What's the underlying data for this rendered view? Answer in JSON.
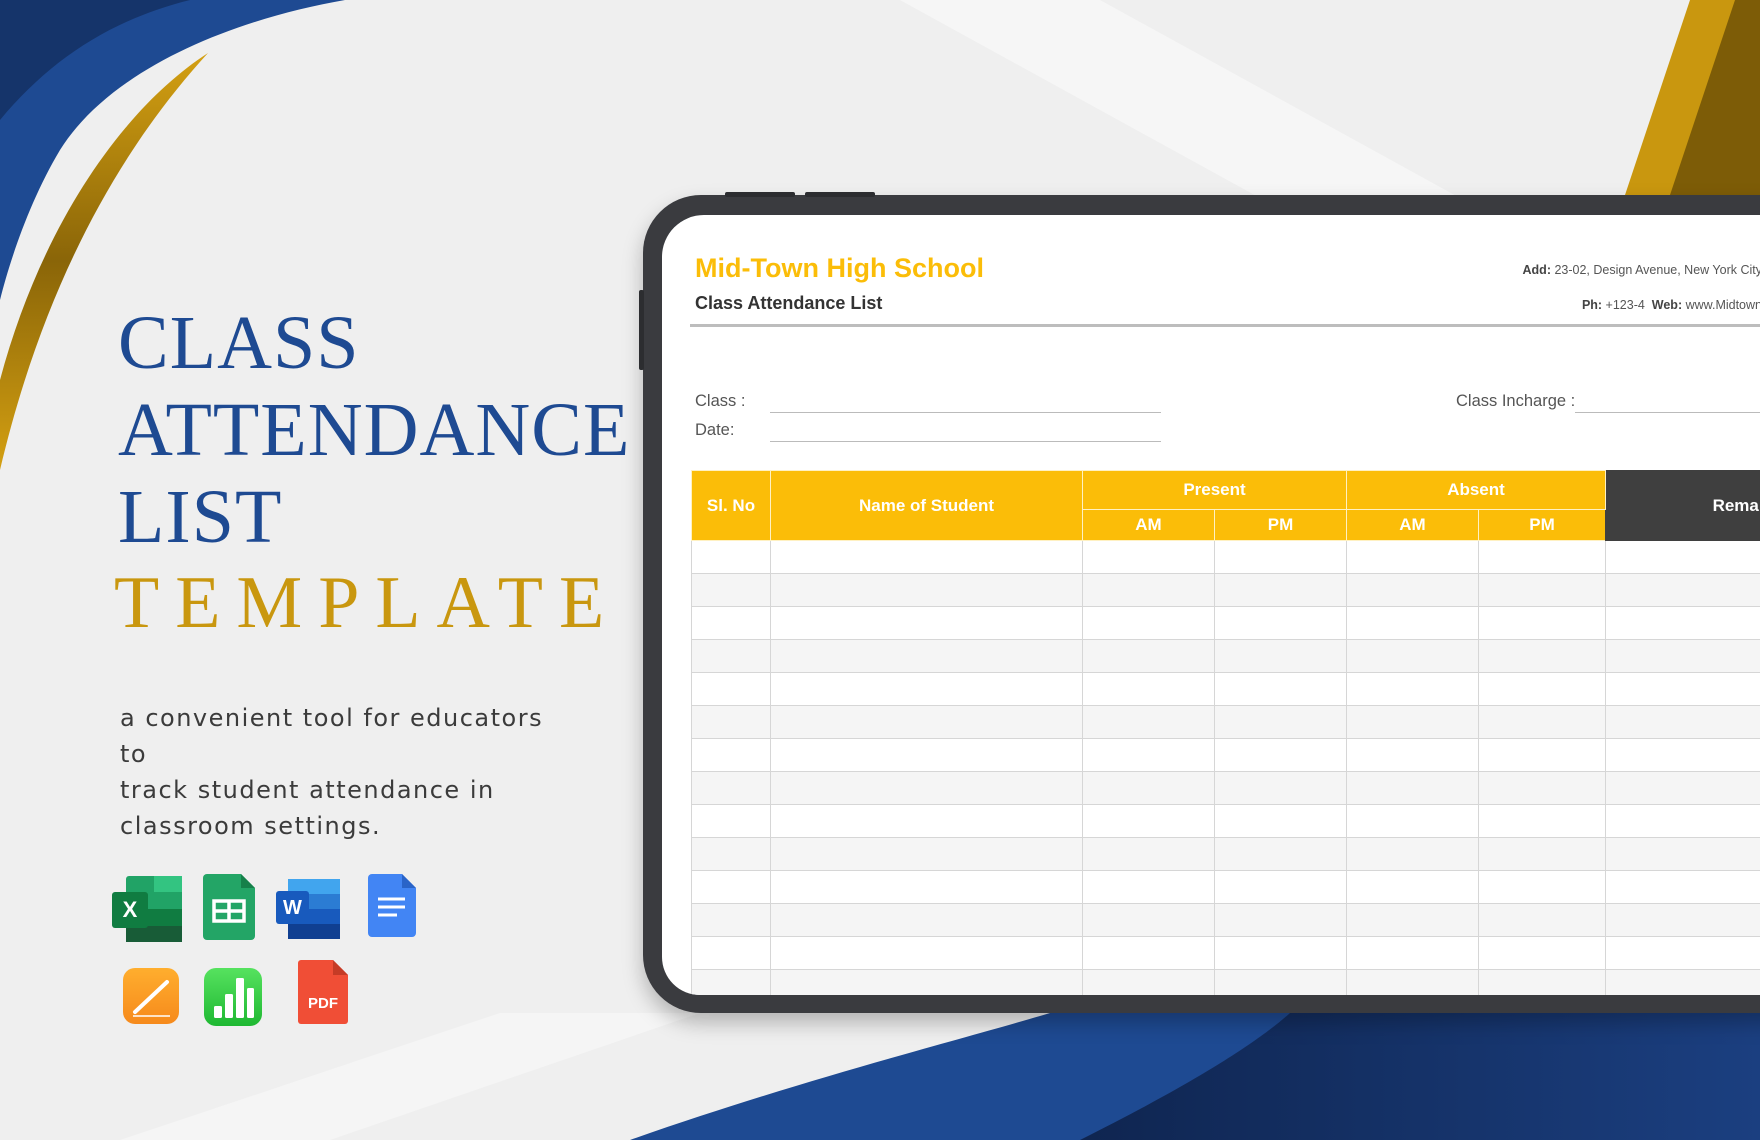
{
  "hero": {
    "title_lines": [
      "CLASS",
      "ATTENDANCE",
      "LIST"
    ],
    "subtitle": "TEMPLATE",
    "description_lines": [
      "a convenient tool for educators to",
      "track student attendance in",
      "classroom settings."
    ]
  },
  "formats": [
    {
      "name": "Microsoft Excel",
      "icon": "excel-icon",
      "letter": "X"
    },
    {
      "name": "Google Sheets",
      "icon": "google-sheets-icon"
    },
    {
      "name": "Microsoft Word",
      "icon": "word-icon",
      "letter": "W"
    },
    {
      "name": "Google Docs",
      "icon": "google-docs-icon"
    },
    {
      "name": "Apple Pages",
      "icon": "pages-icon"
    },
    {
      "name": "Apple Numbers",
      "icon": "numbers-icon"
    },
    {
      "name": "PDF",
      "icon": "pdf-icon",
      "label": "PDF"
    }
  ],
  "document": {
    "school_name": "Mid-Town High School",
    "title": "Class Attendance List",
    "address_label": "Add:",
    "address_value": " 23-02, Design Avenue, New York City",
    "phone_label": "Ph:",
    "phone_value": " +123-4",
    "web_label": "Web:",
    "web_value": " www.Midtown",
    "fields": {
      "class_label": "Class :",
      "date_label": "Date:",
      "incharge_label": "Class Incharge :"
    },
    "table": {
      "headers": {
        "sl_no": "Sl. No",
        "name": "Name of Student",
        "present": "Present",
        "absent": "Absent",
        "am": "AM",
        "pm": "PM",
        "remarks": "Remarks"
      },
      "row_count": 14
    }
  },
  "colors": {
    "brand_blue": "#1e4a92",
    "brand_gold": "#c9970f",
    "table_header": "#fbbd08",
    "remarks_header": "#3f3f3f"
  }
}
